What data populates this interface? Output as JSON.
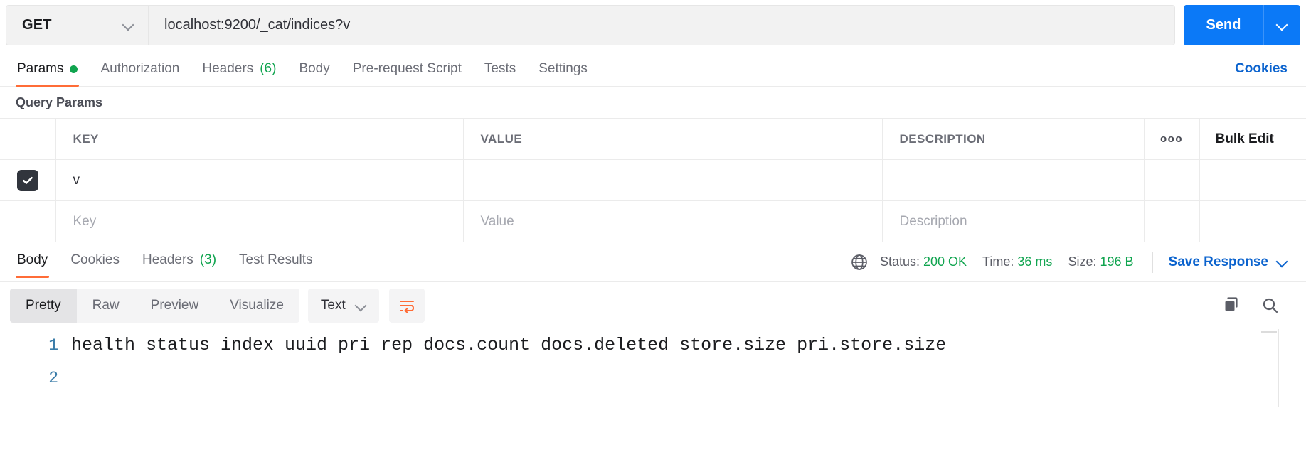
{
  "request": {
    "method": "GET",
    "url": "localhost:9200/_cat/indices?v",
    "send_label": "Send",
    "tabs": [
      {
        "label": "Params",
        "badge": "",
        "dot": true,
        "active": true
      },
      {
        "label": "Authorization",
        "badge": "",
        "dot": false,
        "active": false
      },
      {
        "label": "Headers",
        "badge": "(6)",
        "dot": false,
        "active": false
      },
      {
        "label": "Body",
        "badge": "",
        "dot": false,
        "active": false
      },
      {
        "label": "Pre-request Script",
        "badge": "",
        "dot": false,
        "active": false
      },
      {
        "label": "Tests",
        "badge": "",
        "dot": false,
        "active": false
      },
      {
        "label": "Settings",
        "badge": "",
        "dot": false,
        "active": false
      }
    ],
    "cookies_label": "Cookies"
  },
  "params": {
    "section_title": "Query Params",
    "columns": {
      "key": "KEY",
      "value": "VALUE",
      "description": "DESCRIPTION"
    },
    "options_icon": "ooo",
    "bulk_edit_label": "Bulk Edit",
    "rows": [
      {
        "checked": true,
        "key": "v",
        "value": "",
        "description": ""
      }
    ],
    "placeholders": {
      "key": "Key",
      "value": "Value",
      "description": "Description"
    }
  },
  "response": {
    "tabs": [
      {
        "label": "Body",
        "badge": "",
        "active": true
      },
      {
        "label": "Cookies",
        "badge": "",
        "active": false
      },
      {
        "label": "Headers",
        "badge": "(3)",
        "active": false
      },
      {
        "label": "Test Results",
        "badge": "",
        "active": false
      }
    ],
    "status_label": "Status:",
    "status_value": "200 OK",
    "time_label": "Time:",
    "time_value": "36 ms",
    "size_label": "Size:",
    "size_value": "196 B",
    "save_response_label": "Save Response",
    "view_modes": [
      {
        "label": "Pretty",
        "active": true
      },
      {
        "label": "Raw",
        "active": false
      },
      {
        "label": "Preview",
        "active": false
      },
      {
        "label": "Visualize",
        "active": false
      }
    ],
    "content_type": "Text",
    "lines": [
      {
        "number": "1",
        "text": "health status index uuid pri rep docs.count docs.deleted store.size pri.store.size"
      },
      {
        "number": "2",
        "text": ""
      }
    ]
  },
  "colors": {
    "accent_orange": "#ff6c37",
    "link_blue": "#0b63ce",
    "send_blue": "#0b79f7",
    "success_green": "#10a44f",
    "line_number": "#3a7ca8"
  }
}
